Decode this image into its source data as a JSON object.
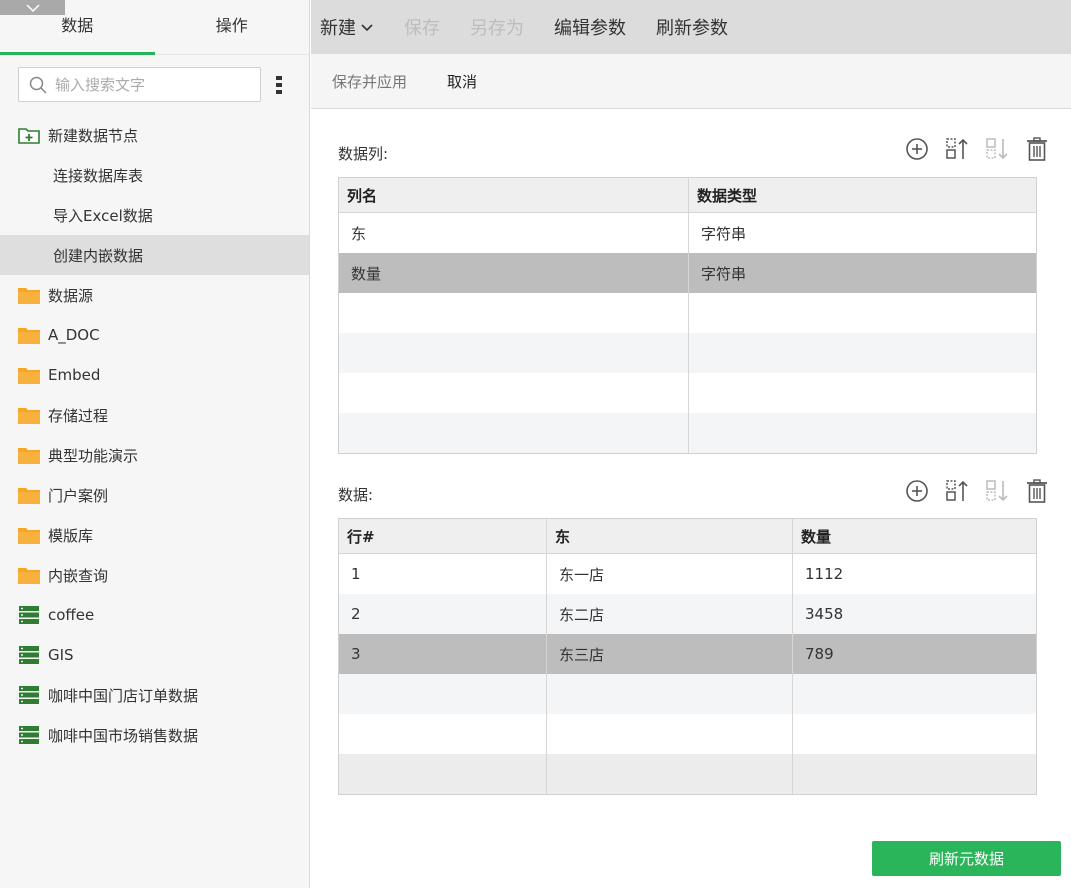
{
  "left_tabs": [
    {
      "label": "数据"
    },
    {
      "label": "操作"
    }
  ],
  "search": {
    "placeholder": "输入搜索文字",
    "value": ""
  },
  "tree": [
    {
      "label": "新建数据节点",
      "icon": "new-folder-icon"
    },
    {
      "label": "连接数据库表",
      "icon": ""
    },
    {
      "label": "导入Excel数据",
      "icon": ""
    },
    {
      "label": "创建内嵌数据",
      "icon": ""
    },
    {
      "label": "数据源",
      "icon": "folder-icon"
    },
    {
      "label": "A_DOC",
      "icon": "folder-icon"
    },
    {
      "label": "Embed",
      "icon": "folder-icon"
    },
    {
      "label": "存储过程",
      "icon": "folder-icon"
    },
    {
      "label": "典型功能演示",
      "icon": "folder-icon"
    },
    {
      "label": "门户案例",
      "icon": "folder-icon"
    },
    {
      "label": "模版库",
      "icon": "folder-icon"
    },
    {
      "label": "内嵌查询",
      "icon": "folder-icon"
    },
    {
      "label": "coffee",
      "icon": "database-icon"
    },
    {
      "label": "GIS",
      "icon": "database-icon"
    },
    {
      "label": "咖啡中国门店订单数据",
      "icon": "database-icon"
    },
    {
      "label": "咖啡中国市场销售数据",
      "icon": "database-icon"
    }
  ],
  "toolbar": {
    "new_label": "新建",
    "save_label": "保存",
    "save_as_label": "另存为",
    "edit_params_label": "编辑参数",
    "refresh_params_label": "刷新参数"
  },
  "subbar": {
    "save_apply_label": "保存并应用",
    "cancel_label": "取消"
  },
  "columns_section": {
    "label": "数据列:",
    "headers": [
      "列名",
      "数据类型"
    ],
    "rows": [
      [
        "东",
        "字符串"
      ],
      [
        "数量",
        "字符串"
      ]
    ]
  },
  "data_section": {
    "label": "数据:",
    "headers": [
      "行#",
      "东",
      "数量"
    ],
    "rows": [
      [
        "1",
        "东一店",
        "1112"
      ],
      [
        "2",
        "东二店",
        "3458"
      ],
      [
        "3",
        "东三店",
        "789"
      ]
    ]
  },
  "refresh_button_label": "刷新元数据",
  "colors": {
    "accent": "#26b45a",
    "folder": "#f5a623",
    "database": "#2e7d32",
    "selected_row": "#bdbdbd"
  }
}
